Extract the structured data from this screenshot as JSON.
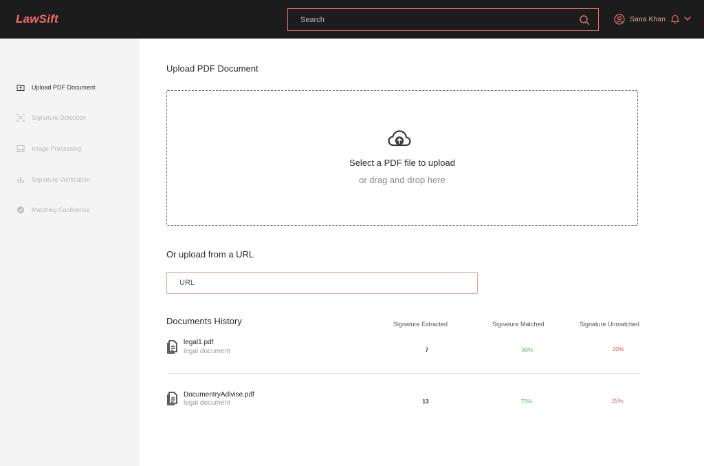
{
  "app": {
    "logo": "LawSift"
  },
  "header": {
    "search_placeholder": "Search",
    "user_name": "Sana Khan"
  },
  "sidebar": {
    "items": [
      {
        "label": "Upload PDF Document",
        "icon": "upload-icon",
        "active": true
      },
      {
        "label": "Signature Detection",
        "icon": "scan-icon",
        "active": false
      },
      {
        "label": "Image Processing",
        "icon": "image-icon",
        "active": false
      },
      {
        "label": "Signature Verification",
        "icon": "bar-chart-icon",
        "active": false
      },
      {
        "label": "Matching Confidence",
        "icon": "check-circle-icon",
        "active": false
      }
    ]
  },
  "upload": {
    "heading": "Upload PDF Document",
    "dropzone_title": "Select a PDF file to upload",
    "dropzone_subtitle": "or drag and drop here"
  },
  "url_upload": {
    "heading": "Or upload from a URL",
    "placeholder": "URL"
  },
  "history": {
    "heading": "Documents History",
    "columns": [
      "Signature Extracted",
      "Signature Matched",
      "Signature Unmatched"
    ],
    "rows": [
      {
        "name": "legal1.pdf",
        "type": "legal document",
        "extracted": "7",
        "matched": "80%",
        "unmatched": "20%"
      },
      {
        "name": "DocumentryAdivise.pdf",
        "type": "legal document",
        "extracted": "13",
        "matched": "75%",
        "unmatched": "25%"
      }
    ]
  },
  "colors": {
    "accent": "#f26b6b",
    "topbar": "#1c1c1c",
    "sidebar": "#f4f4f4",
    "good": "#5cb85c",
    "bad": "#e05a4f"
  }
}
